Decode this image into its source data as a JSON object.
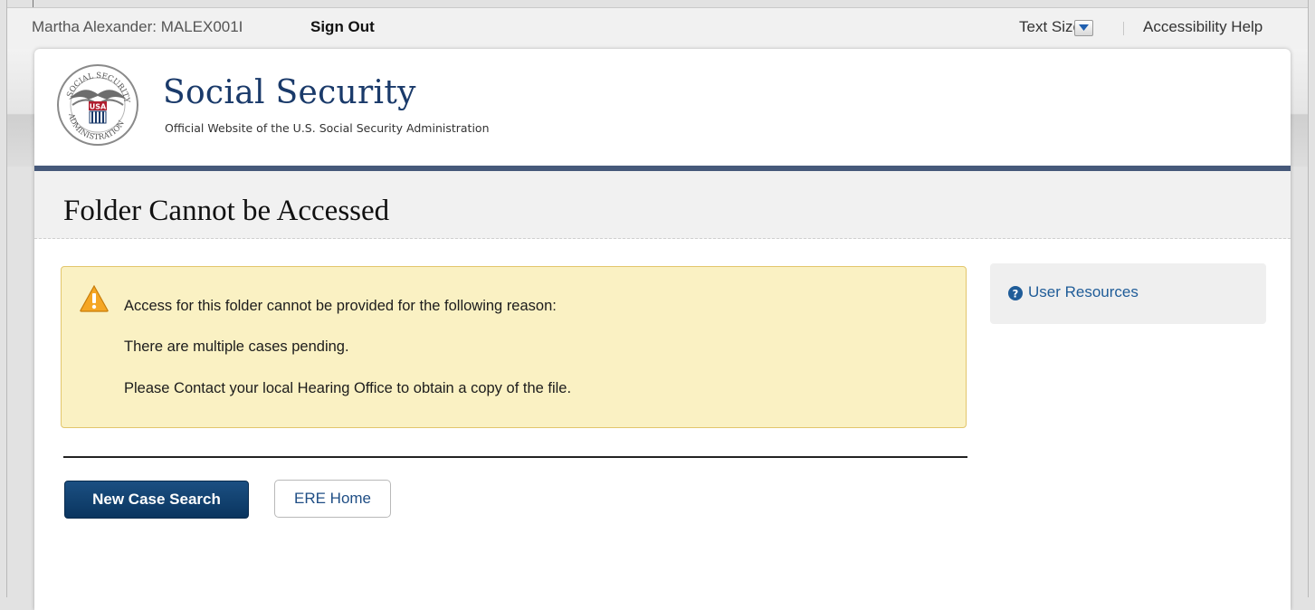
{
  "topbar": {
    "user_name": "Martha Alexander: MALEX001I",
    "sign_out": "Sign Out",
    "text_size": "Text Size",
    "accessibility_help": "Accessibility Help"
  },
  "header": {
    "site_title": "Social Security",
    "site_subtitle": "Official Website of the U.S. Social Security Administration",
    "seal_text": "SOCIAL SECURITY ADMINISTRATION USA"
  },
  "page": {
    "title": "Folder Cannot be Accessed"
  },
  "alert": {
    "icon": "warning-icon",
    "line1": "Access for this folder cannot be provided for the following reason:",
    "line2": "There are multiple cases pending.",
    "line3": "Please Contact your local Hearing Office to obtain a copy of the file."
  },
  "actions": {
    "new_case_search": "New Case Search",
    "ere_home": "ERE Home"
  },
  "sidebar": {
    "icon": "help-icon",
    "user_resources": "User Resources"
  },
  "colors": {
    "brand_navy": "#1a3a6a",
    "header_rule": "#46597a",
    "primary_button": "#0e3c6b",
    "alert_background": "#faf1c3",
    "alert_border": "#e2c66c",
    "link": "#1f5c98"
  }
}
